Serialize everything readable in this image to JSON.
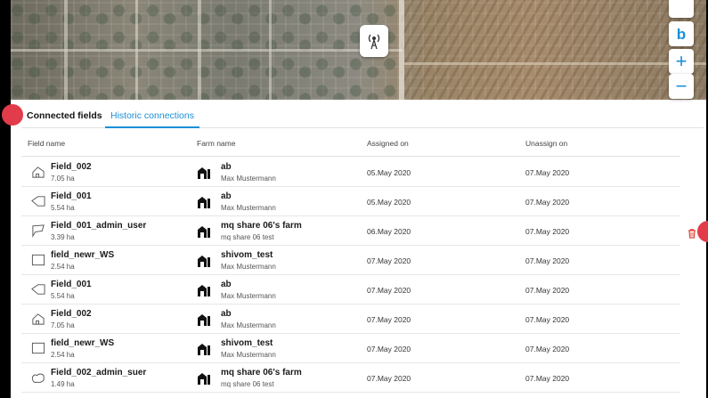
{
  "map": {
    "pin_icon": "antenna-icon",
    "controls": [
      {
        "name": "bing-button",
        "icon": "bing-icon",
        "label": "b"
      },
      {
        "name": "zoom-in-button",
        "icon": "plus-icon",
        "label": "+"
      },
      {
        "name": "zoom-out-button",
        "icon": "minus-icon",
        "label": "−"
      }
    ]
  },
  "tabs": [
    {
      "label": "Connected fields",
      "active": false
    },
    {
      "label": "Historic connections",
      "active": true
    }
  ],
  "table": {
    "headers": [
      "Field name",
      "Farm name",
      "Assigned on",
      "Unassign on"
    ],
    "rows": [
      {
        "field": "Field_002",
        "size": "7.05 ha",
        "shape": "house",
        "farm": "ab",
        "owner": "Max Mustermann",
        "assigned": "05.May 2020",
        "unassigned": "07.May 2020"
      },
      {
        "field": "Field_001",
        "size": "5.54 ha",
        "shape": "arrow",
        "farm": "ab",
        "owner": "Max Mustermann",
        "assigned": "05.May 2020",
        "unassigned": "07.May 2020"
      },
      {
        "field": "Field_001_admin_user",
        "size": "3.39 ha",
        "shape": "flag",
        "farm": "mq share 06's farm",
        "owner": "mq share 06 test",
        "assigned": "06.May 2020",
        "unassigned": "07.May 2020"
      },
      {
        "field": "field_newr_WS",
        "size": "2.54 ha",
        "shape": "square",
        "farm": "shivom_test",
        "owner": "Max Mustermann",
        "assigned": "07.May 2020",
        "unassigned": "07.May 2020"
      },
      {
        "field": "Field_001",
        "size": "5.54 ha",
        "shape": "arrow",
        "farm": "ab",
        "owner": "Max Mustermann",
        "assigned": "07.May 2020",
        "unassigned": "07.May 2020"
      },
      {
        "field": "Field_002",
        "size": "7.05 ha",
        "shape": "house",
        "farm": "ab",
        "owner": "Max Mustermann",
        "assigned": "07.May 2020",
        "unassigned": "07.May 2020"
      },
      {
        "field": "field_newr_WS",
        "size": "2.54 ha",
        "shape": "square",
        "farm": "shivom_test",
        "owner": "Max Mustermann",
        "assigned": "07.May 2020",
        "unassigned": "07.May 2020"
      },
      {
        "field": "Field_002_admin_suer",
        "size": "1.49 ha",
        "shape": "blob",
        "farm": "mq share 06's farm",
        "owner": "mq share 06 test",
        "assigned": "07.May 2020",
        "unassigned": "07.May 2020"
      }
    ]
  },
  "colors": {
    "accent": "#1b8fd6",
    "marker": "#e23b4a",
    "delete": "#e0443c"
  }
}
